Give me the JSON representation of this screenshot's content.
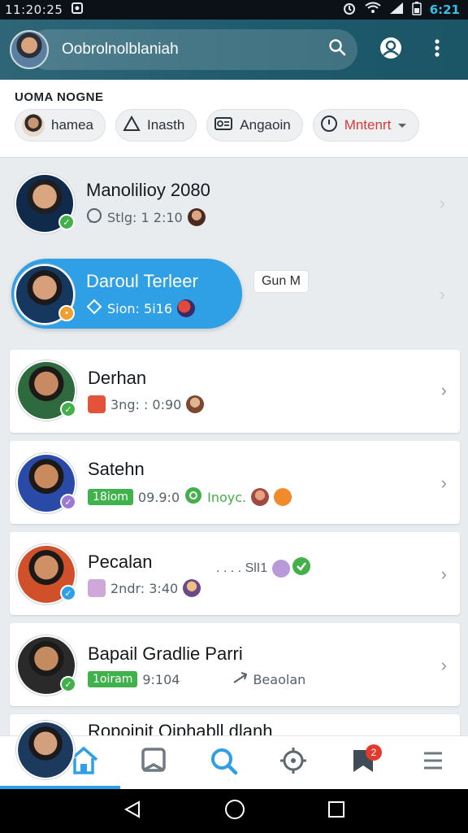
{
  "status_bar": {
    "time": "11:20:25",
    "battery_text": "6:21"
  },
  "app_bar": {
    "search_text": "Oobrolnolblaniah"
  },
  "filters": {
    "title": "UOMA NOGNE",
    "chips": [
      {
        "label": "hamea",
        "icon": "avatar"
      },
      {
        "label": "Inasth",
        "icon": "triangle-icon"
      },
      {
        "label": "Angaoin",
        "icon": "card-icon"
      },
      {
        "label": "Mntenrt",
        "icon": "clock-icon",
        "color": "#d83a3a"
      }
    ]
  },
  "contacts": [
    {
      "name": "Manolilioy 2080",
      "meta": "Stlg: 1 2:10",
      "status_color": "#43b04a"
    },
    {
      "name": "Daroul Terleer",
      "meta": "Sion: 5i16",
      "status_color": "#f0a030",
      "tag": "Gun M"
    },
    {
      "name": "Derhan",
      "meta": "3ng: : 0:90",
      "status_color": "#43b04a"
    },
    {
      "name": "Satehn",
      "meta": "09.9:0",
      "badge": "18iom",
      "extra": "Inoyc.",
      "status_color": "#9b7ad6"
    },
    {
      "name": "Pecalan",
      "meta": "2ndr: 3:40",
      "extra": ". . . . SlI1",
      "status_color": "#2f9fe6"
    },
    {
      "name": "Bapail Gradlie Parri",
      "meta": "9:104",
      "badge": "1oiram",
      "extra": "Beaolan",
      "status_color": "#43b04a"
    },
    {
      "name": "Ropoinit Oiphabll dlanh",
      "meta": "",
      "status_color": "#43b04a"
    }
  ],
  "bottom_nav": {
    "badge_count": "2"
  },
  "colors": {
    "accent": "#2f9fe6",
    "app_bar": "#1e5a6c",
    "online": "#43b04a"
  }
}
